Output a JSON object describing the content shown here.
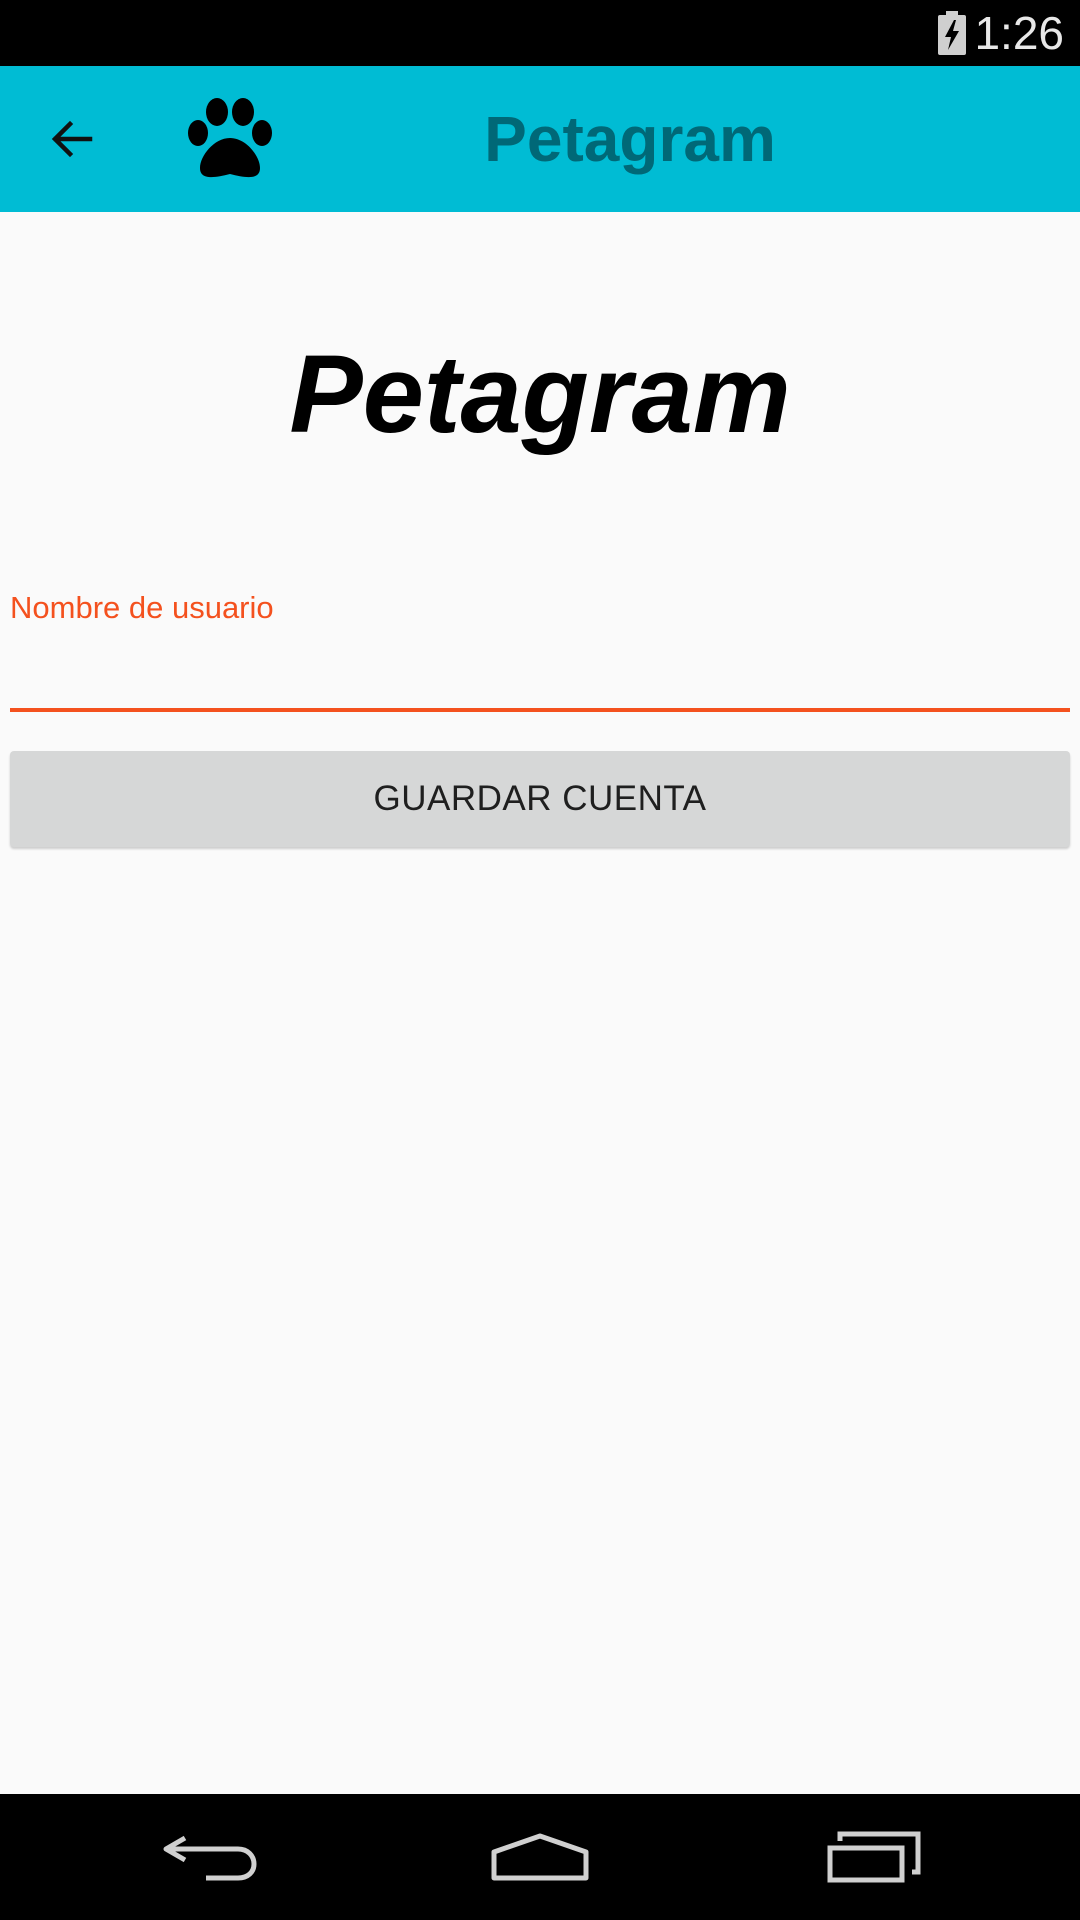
{
  "status_bar": {
    "time": "1:26",
    "battery_icon": "battery-charging-icon"
  },
  "toolbar": {
    "back_icon": "arrow-back-icon",
    "logo_icon": "paw-icon",
    "title": "Petagram",
    "background": "#00bcd4",
    "title_color": "#006877"
  },
  "main": {
    "brand_title": "Petagram",
    "username_field": {
      "label": "Nombre de usuario",
      "value": "",
      "accent": "#f4511e"
    },
    "save_button_label": "GUARDAR CUENTA"
  },
  "nav_bar": {
    "back_icon": "nav-back-icon",
    "home_icon": "nav-home-icon",
    "recents_icon": "nav-recents-icon"
  }
}
